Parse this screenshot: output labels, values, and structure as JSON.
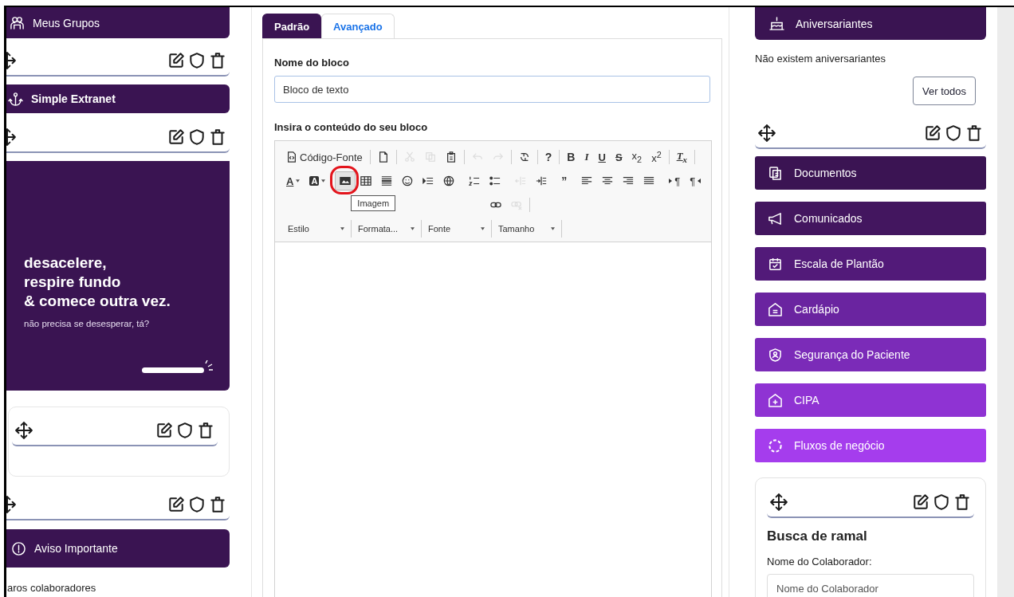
{
  "left": {
    "groups_title": "Meus Grupos",
    "extranet_title": "Simple Extranet",
    "banner": {
      "headline": [
        "desacelere,",
        "respire fundo",
        "& comece outra vez."
      ],
      "subline": "não precisa se desesperar, tá?"
    },
    "notice_title": "Aviso Importante",
    "footer_text": "aros colaboradores"
  },
  "tabs": [
    {
      "label": "Padrão",
      "selected": true
    },
    {
      "label": "Avançado",
      "selected": false
    }
  ],
  "form": {
    "name_label": "Nome do bloco",
    "name_value": "Bloco de texto",
    "content_label": "Insira o conteúdo do seu bloco"
  },
  "editor": {
    "toolbar": [
      [
        [
          {
            "kind": "source",
            "label": "Código-Fonte",
            "disabled": false,
            "pressed": false
          }
        ],
        [
          {
            "kind": "new-page",
            "disabled": false,
            "pressed": false
          }
        ],
        [
          {
            "kind": "cut",
            "disabled": true,
            "pressed": false
          },
          {
            "kind": "copy",
            "disabled": true,
            "pressed": false
          },
          {
            "kind": "paste",
            "disabled": false,
            "pressed": false
          }
        ],
        [
          {
            "kind": "undo",
            "disabled": true,
            "pressed": false
          },
          {
            "kind": "redo",
            "disabled": true,
            "pressed": false
          }
        ],
        [
          {
            "kind": "find-replace",
            "disabled": false,
            "pressed": false
          }
        ],
        [
          {
            "kind": "help",
            "label": "?",
            "disabled": false,
            "pressed": false
          }
        ],
        [
          {
            "kind": "bold",
            "label": "B",
            "disabled": false,
            "pressed": false
          },
          {
            "kind": "italic",
            "label": "I",
            "disabled": false,
            "pressed": false
          },
          {
            "kind": "underline",
            "label": "U",
            "disabled": false,
            "pressed": false
          },
          {
            "kind": "strike",
            "label": "S",
            "disabled": false,
            "pressed": false
          },
          {
            "kind": "subscript",
            "label": "x$_{2}$",
            "disabled": false,
            "pressed": false
          },
          {
            "kind": "superscript",
            "label": "x$^{2}$",
            "disabled": false,
            "pressed": false
          }
        ],
        [
          {
            "kind": "remove-format",
            "label": "T$_{x}$",
            "disabled": false,
            "pressed": false
          }
        ]
      ],
      [
        [
          {
            "kind": "text-color",
            "label": "A",
            "disabled": false,
            "pressed": false
          },
          {
            "kind": "background-color",
            "label": "A",
            "disabled": false,
            "pressed": false
          }
        ],
        [
          {
            "kind": "image",
            "disabled": false,
            "pressed": true,
            "circled": true,
            "tooltip": "Imagem"
          },
          {
            "kind": "table",
            "disabled": false,
            "pressed": false
          },
          {
            "kind": "horizontal-line",
            "disabled": false,
            "pressed": false
          },
          {
            "kind": "smiley",
            "disabled": false,
            "pressed": false
          },
          {
            "kind": "show-blocks",
            "disabled": false,
            "pressed": false
          },
          {
            "kind": "globe",
            "disabled": false,
            "pressed": false
          }
        ],
        [
          {
            "kind": "numbered-list",
            "disabled": false,
            "pressed": false
          },
          {
            "kind": "bulleted-list",
            "disabled": false,
            "pressed": false
          }
        ],
        [
          {
            "kind": "outdent",
            "disabled": true,
            "pressed": false
          },
          {
            "kind": "indent",
            "disabled": false,
            "pressed": false
          }
        ],
        [
          {
            "kind": "blockquote",
            "label": "”",
            "disabled": false,
            "pressed": false
          }
        ],
        [
          {
            "kind": "align-left",
            "disabled": false,
            "pressed": false
          },
          {
            "kind": "align-center",
            "disabled": false,
            "pressed": false
          },
          {
            "kind": "align-right",
            "disabled": false,
            "pressed": false
          },
          {
            "kind": "justify",
            "disabled": false,
            "pressed": false
          }
        ],
        [
          {
            "kind": "left-to-right",
            "label": "¶",
            "disabled": false,
            "pressed": false
          },
          {
            "kind": "right-to-left",
            "label": "¶",
            "disabled": false,
            "pressed": false
          }
        ]
      ],
      [
        [
          {
            "kind": "link",
            "disabled": false,
            "pressed": false
          },
          {
            "kind": "unlink",
            "disabled": true,
            "pressed": false
          }
        ]
      ]
    ],
    "dropdowns": [
      "Estilo",
      "Formata...",
      "Fonte",
      "Tamanho"
    ]
  },
  "birthdays": {
    "title": "Aniversariantes",
    "empty_text": "Não existem aniversariantes",
    "button": "Ver todos"
  },
  "menu": [
    {
      "label": "Documentos",
      "color": "#3b1453"
    },
    {
      "label": "Comunicados",
      "color": "#43165f"
    },
    {
      "label": "Escala de Plantão",
      "color": "#521a79"
    },
    {
      "label": "Cardápio",
      "color": "#6a24a0"
    },
    {
      "label": "Segurança do Paciente",
      "color": "#7b2bb8"
    },
    {
      "label": "CIPA",
      "color": "#8f33d3"
    },
    {
      "label": "Fluxos de negócio",
      "color": "#a53ded"
    }
  ],
  "extension_search": {
    "title": "Busca de ramal",
    "label": "Nome do Colaborador:",
    "placeholder": "Nome do Colaborador"
  }
}
